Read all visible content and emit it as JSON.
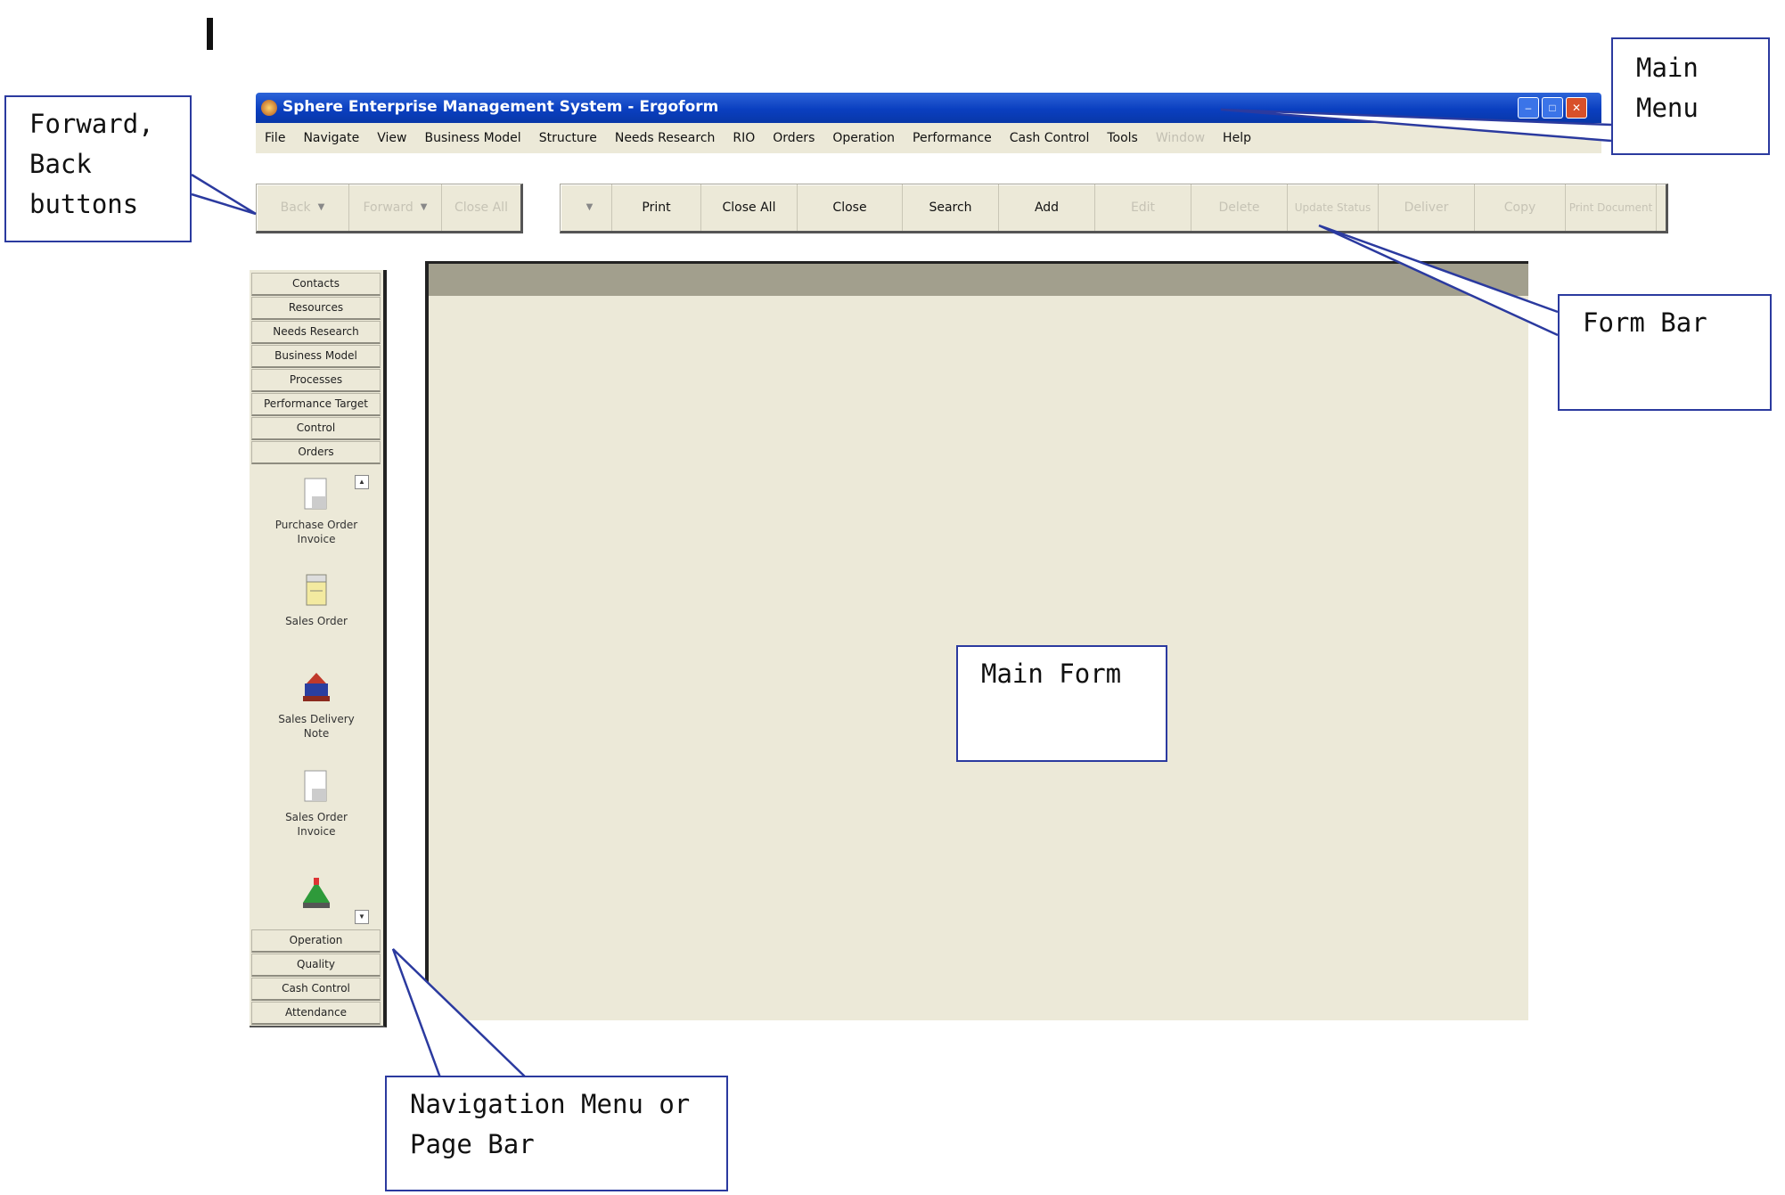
{
  "window": {
    "title": "Sphere Enterprise Management System - Ergoform",
    "controls": [
      "minimize",
      "maximize",
      "close"
    ]
  },
  "menu": {
    "items": [
      {
        "label": "File",
        "enabled": true
      },
      {
        "label": "Navigate",
        "enabled": true
      },
      {
        "label": "View",
        "enabled": true
      },
      {
        "label": "Business Model",
        "enabled": true
      },
      {
        "label": "Structure",
        "enabled": true
      },
      {
        "label": "Needs Research",
        "enabled": true
      },
      {
        "label": "RIO",
        "enabled": true
      },
      {
        "label": "Orders",
        "enabled": true
      },
      {
        "label": "Operation",
        "enabled": true
      },
      {
        "label": "Performance",
        "enabled": true
      },
      {
        "label": "Cash Control",
        "enabled": true
      },
      {
        "label": "Tools",
        "enabled": true
      },
      {
        "label": "Window",
        "enabled": false
      },
      {
        "label": "Help",
        "enabled": true
      }
    ]
  },
  "nav_toolbar": {
    "back": "Back",
    "forward": "Forward",
    "close_all": "Close All"
  },
  "form_bar": {
    "buttons": [
      {
        "label": "Print",
        "enabled": true
      },
      {
        "label": "Close All",
        "enabled": true
      },
      {
        "label": "Close",
        "enabled": true
      },
      {
        "label": "Search",
        "enabled": true
      },
      {
        "label": "Add",
        "enabled": true
      },
      {
        "label": "Edit",
        "enabled": false
      },
      {
        "label": "Delete",
        "enabled": false
      },
      {
        "label": "Update Status",
        "enabled": false
      },
      {
        "label": "Deliver",
        "enabled": false
      },
      {
        "label": "Copy",
        "enabled": false
      },
      {
        "label": "Print Document",
        "enabled": false
      }
    ]
  },
  "page_bar": {
    "top_groups": [
      "Contacts",
      "Resources",
      "Needs Research",
      "Business Model",
      "Processes",
      "Performance Target",
      "Control",
      "Orders"
    ],
    "orders_items": [
      {
        "label": "Purchase Order Invoice",
        "icon": "document-icon"
      },
      {
        "label": "Sales Order",
        "icon": "sales-order-icon"
      },
      {
        "label": "Sales Delivery Note",
        "icon": "delivery-truck-icon"
      },
      {
        "label": "Sales Order Invoice",
        "icon": "document-icon"
      },
      {
        "label": "",
        "icon": "green-house-icon"
      }
    ],
    "bottom_groups": [
      "Operation",
      "Quality",
      "Cash Control",
      "Attendance"
    ]
  },
  "callouts": {
    "main_menu": "Main\nMenu",
    "forward_back": "Forward,\nBack\nbuttons",
    "form_bar": "Form Bar",
    "main_form": "Main Form",
    "navigation": "Navigation Menu or\nPage Bar"
  },
  "colors": {
    "titlebar": "#0a3fc0",
    "chrome": "#ece9d8",
    "callout_border": "#2b3a9f"
  }
}
